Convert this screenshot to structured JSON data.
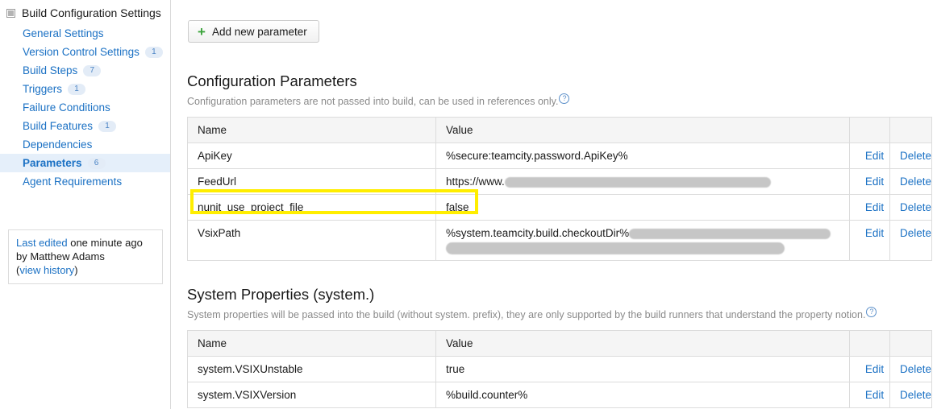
{
  "sidebar": {
    "root_label": "Build Configuration Settings",
    "items": [
      {
        "label": "General Settings",
        "badge": ""
      },
      {
        "label": "Version Control Settings",
        "badge": "1"
      },
      {
        "label": "Build Steps",
        "badge": "7"
      },
      {
        "label": "Triggers",
        "badge": "1"
      },
      {
        "label": "Failure Conditions",
        "badge": ""
      },
      {
        "label": "Build Features",
        "badge": "1"
      },
      {
        "label": "Dependencies",
        "badge": ""
      },
      {
        "label": "Parameters",
        "badge": "6"
      },
      {
        "label": "Agent Requirements",
        "badge": ""
      }
    ],
    "selected_index": 7,
    "last_edited": {
      "link_label": "Last edited",
      "when": " one minute ago",
      "by": "by Matthew Adams",
      "history_open": "(",
      "history_link": "view history",
      "history_close": ")"
    }
  },
  "toolbar": {
    "add_param_label": "Add new parameter",
    "plus_icon": "+"
  },
  "config_section": {
    "title": "Configuration Parameters",
    "description": "Configuration parameters are not passed into build, can be used in references only.",
    "help_icon": "?",
    "headers": {
      "name": "Name",
      "value": "Value",
      "edit": "",
      "delete": ""
    },
    "rows": [
      {
        "name": "ApiKey",
        "value": "%secure:teamcity.password.ApiKey%",
        "edit": "Edit",
        "delete": "Delete",
        "redacted": false,
        "highlighted": false
      },
      {
        "name": "FeedUrl",
        "value": "https://www.",
        "edit": "Edit",
        "delete": "Delete",
        "redacted": true,
        "highlighted": false
      },
      {
        "name": "nunit_use_project_file",
        "value": "false",
        "edit": "Edit",
        "delete": "Delete",
        "redacted": false,
        "highlighted": true
      },
      {
        "name": "VsixPath",
        "value": "%system.teamcity.build.checkoutDir%",
        "edit": "Edit",
        "delete": "Delete",
        "redacted": true,
        "highlighted": false
      }
    ]
  },
  "system_section": {
    "title": "System Properties (system.)",
    "description": "System properties will be passed into the build (without system. prefix), they are only supported by the build runners that understand the property notion.",
    "help_icon": "?",
    "headers": {
      "name": "Name",
      "value": "Value",
      "edit": "",
      "delete": ""
    },
    "rows": [
      {
        "name": "system.VSIXUnstable",
        "value": "true",
        "edit": "Edit",
        "delete": "Delete"
      },
      {
        "name": "system.VSIXVersion",
        "value": "%build.counter%",
        "edit": "Edit",
        "delete": "Delete"
      }
    ]
  },
  "colors": {
    "link": "#1b71c4",
    "highlight": "#ffee00",
    "selected_row": "#e5effa",
    "plus_green": "#3aa33a",
    "border": "#dcdcdc"
  }
}
